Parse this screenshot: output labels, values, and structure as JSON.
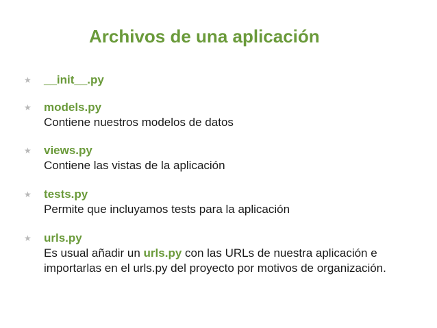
{
  "slide": {
    "title": "Archivos de una aplicación",
    "items": [
      {
        "name": "__init__.py",
        "description": ""
      },
      {
        "name": "models.py",
        "description": "Contiene nuestros modelos de datos"
      },
      {
        "name": "views.py",
        "description": "Contiene las vistas de la aplicación"
      },
      {
        "name": "tests.py",
        "description": "Permite que incluyamos tests para la aplicación"
      },
      {
        "name": "urls.py",
        "description_before": "Es usual añadir un ",
        "description_highlight": "urls.py",
        "description_after": " con las URLs de nuestra aplicación e importarlas en el urls.py del proyecto por motivos de organización."
      }
    ],
    "bullet_icon": "star-icon",
    "colors": {
      "accent": "#6a9a3a",
      "text": "#1a1a1a",
      "bullet": "#b8b8b8",
      "background": "#ffffff"
    }
  }
}
